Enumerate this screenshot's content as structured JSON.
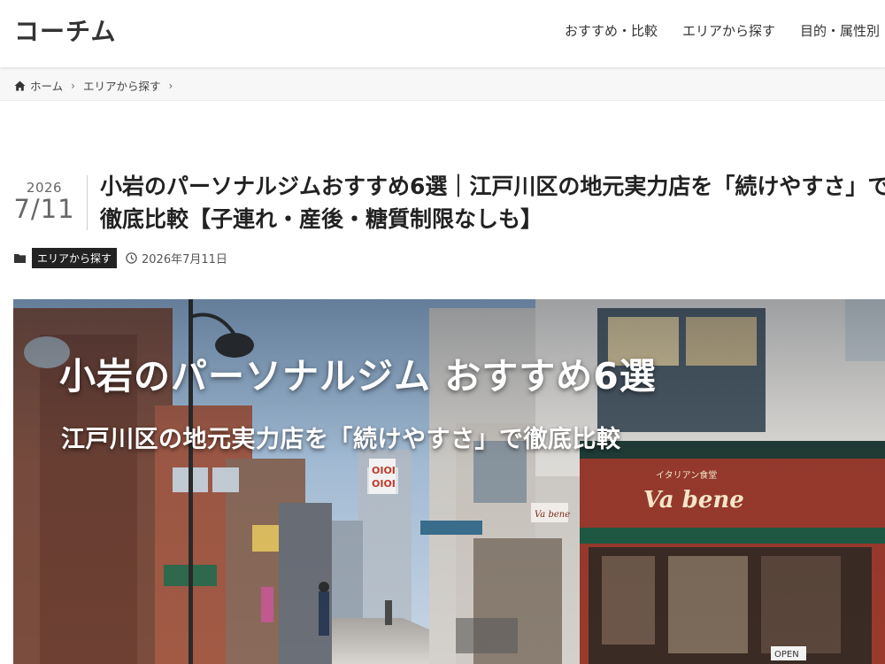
{
  "header": {
    "site_name": "コーチム",
    "nav": [
      "おすすめ・比較",
      "エリアから探す",
      "目的・属性別"
    ]
  },
  "breadcrumb": {
    "items": [
      "ホーム",
      "エリアから探す"
    ],
    "separator": "›"
  },
  "post": {
    "date_year": "2026",
    "date_md": "7/11",
    "title": "小岩のパーソナルジムおすすめ6選｜江戸川区の地元実力店を「続けやすさ」で徹底比較【子連れ・産後・糖質制限なしも】",
    "category": "エリアから探す",
    "published": "2026年7月11日"
  },
  "eyecatch": {
    "title": "小岩のパーソナルジム おすすめ6選",
    "subtitle": "江戸川区の地元実力店を「続けやすさ」で徹底比較",
    "signs": {
      "oioi_1": "OIOI",
      "oioi_2": "OIOI",
      "restaurant_small": "イタリアン食堂",
      "restaurant_name": "Va bene",
      "hanging_sign": "Va bene",
      "open_sign": "OPEN"
    }
  },
  "colors": {
    "badge_bg": "#222222",
    "header_bg": "#ffffff",
    "breadcrumb_bg": "#f7f7f7"
  },
  "icons": [
    "home-icon",
    "folder-icon",
    "clock-icon"
  ]
}
